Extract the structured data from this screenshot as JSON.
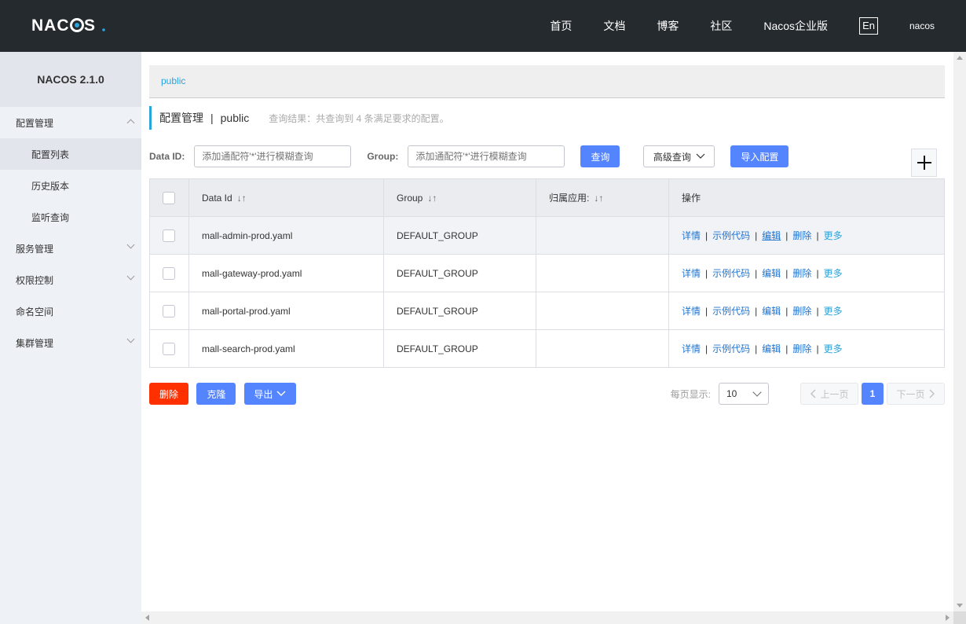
{
  "header": {
    "logo_text": "NACOS.",
    "nav": [
      "首页",
      "文档",
      "博客",
      "社区",
      "Nacos企业版"
    ],
    "lang": "En",
    "user": "nacos"
  },
  "sidebar": {
    "title": "NACOS 2.1.0",
    "items": [
      {
        "label": "配置管理",
        "level": 1,
        "expanded": true
      },
      {
        "label": "配置列表",
        "level": 2,
        "active": true
      },
      {
        "label": "历史版本",
        "level": 2
      },
      {
        "label": "监听查询",
        "level": 2
      },
      {
        "label": "服务管理",
        "level": 1,
        "expanded": false
      },
      {
        "label": "权限控制",
        "level": 1,
        "expanded": false
      },
      {
        "label": "命名空间",
        "level": 1
      },
      {
        "label": "集群管理",
        "level": 1,
        "expanded": false
      }
    ]
  },
  "main": {
    "namespace_link": "public",
    "page_title": "配置管理",
    "separator": "|",
    "namespace": "public",
    "result_text": "查询结果：共查询到 4 条满足要求的配置。",
    "filters": {
      "dataid_label": "Data ID:",
      "dataid_placeholder": "添加通配符'*'进行模糊查询",
      "group_label": "Group:",
      "group_placeholder": "添加通配符'*'进行模糊查询",
      "query_btn": "查询",
      "advanced_btn": "高级查询",
      "import_btn": "导入配置"
    },
    "table": {
      "columns": [
        "Data Id",
        "Group",
        "归属应用:",
        "操作"
      ],
      "rows": [
        {
          "data_id": "mall-admin-prod.yaml",
          "group": "DEFAULT_GROUP",
          "app": ""
        },
        {
          "data_id": "mall-gateway-prod.yaml",
          "group": "DEFAULT_GROUP",
          "app": ""
        },
        {
          "data_id": "mall-portal-prod.yaml",
          "group": "DEFAULT_GROUP",
          "app": ""
        },
        {
          "data_id": "mall-search-prod.yaml",
          "group": "DEFAULT_GROUP",
          "app": ""
        }
      ],
      "ops": {
        "detail": "详情",
        "sample": "示例代码",
        "edit": "编辑",
        "delete": "删除",
        "more": "更多",
        "sep": "|"
      }
    },
    "actions": {
      "delete": "删除",
      "clone": "克隆",
      "export": "导出"
    },
    "pager": {
      "per_page_label": "每页显示:",
      "per_page_value": "10",
      "prev": "上一页",
      "current": "1",
      "next": "下一页"
    }
  },
  "colors": {
    "topbar": "#252a2f",
    "primary": "#5584ff",
    "danger": "#ff3000",
    "link": "#2174d1",
    "accent": "#2aa4dd"
  }
}
